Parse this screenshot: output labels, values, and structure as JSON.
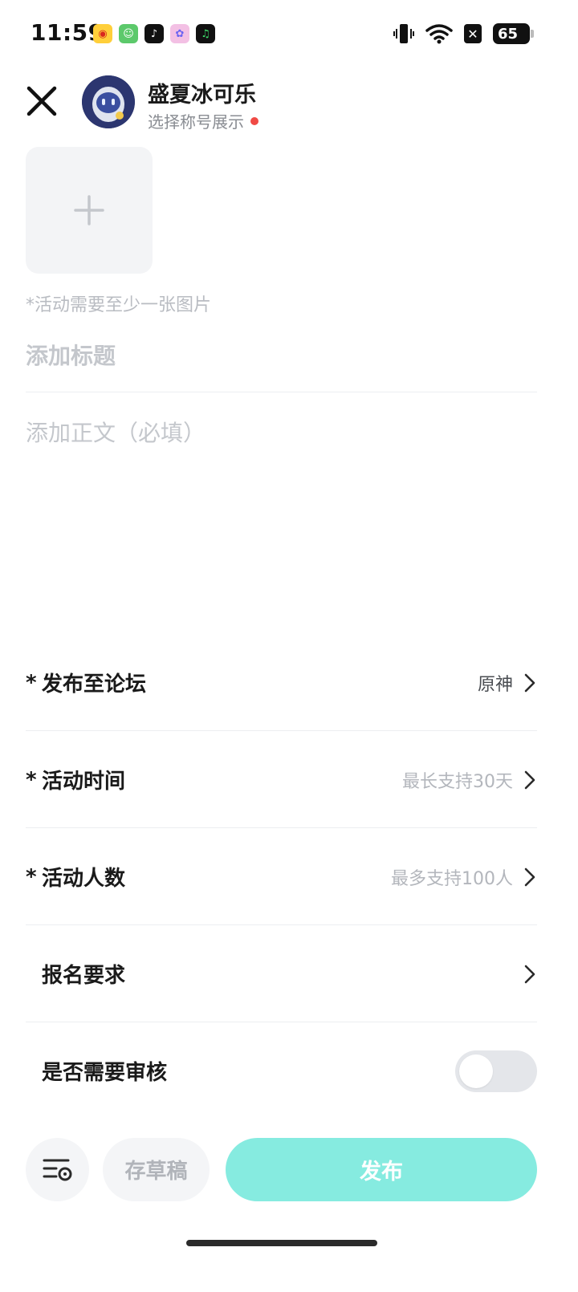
{
  "status_bar": {
    "time": "11:59",
    "apps": [
      {
        "icon": "weibo-icon",
        "glyph": "◉",
        "color": "#ffcf3a"
      },
      {
        "icon": "green-app-icon",
        "glyph": "☺",
        "color": "#5cc96b"
      },
      {
        "icon": "tiktok-icon",
        "glyph": "♪",
        "color": "#111111"
      },
      {
        "icon": "pink-app-icon",
        "glyph": "✿",
        "color": "#f3c0e4"
      },
      {
        "icon": "music-app-icon",
        "glyph": "♫",
        "color": "#111111"
      }
    ],
    "battery": "65",
    "notification_badge": "✕"
  },
  "header": {
    "close_icon": "close-icon",
    "user_name": "盛夏冰可乐",
    "title_select": "选择称号展示",
    "dot_color": "#f04a45"
  },
  "composer": {
    "add_image_icon": "plus-icon",
    "image_hint": "*活动需要至少一张图片",
    "title_placeholder": "添加标题",
    "body_placeholder": "添加正文（必填）"
  },
  "settings": {
    "forum": {
      "required": "*",
      "label": "发布至论坛",
      "value": "原神"
    },
    "time": {
      "required": "*",
      "label": "活动时间",
      "value": "最长支持30天"
    },
    "people": {
      "required": "*",
      "label": "活动人数",
      "value": "最多支持100人"
    },
    "requirements": {
      "label": "报名要求"
    },
    "review": {
      "label": "是否需要审核",
      "enabled": false
    }
  },
  "bottom_bar": {
    "settings_icon": "list-settings-icon",
    "draft_label": "存草稿",
    "publish_label": "发布",
    "publish_color": "#86ebe0"
  }
}
